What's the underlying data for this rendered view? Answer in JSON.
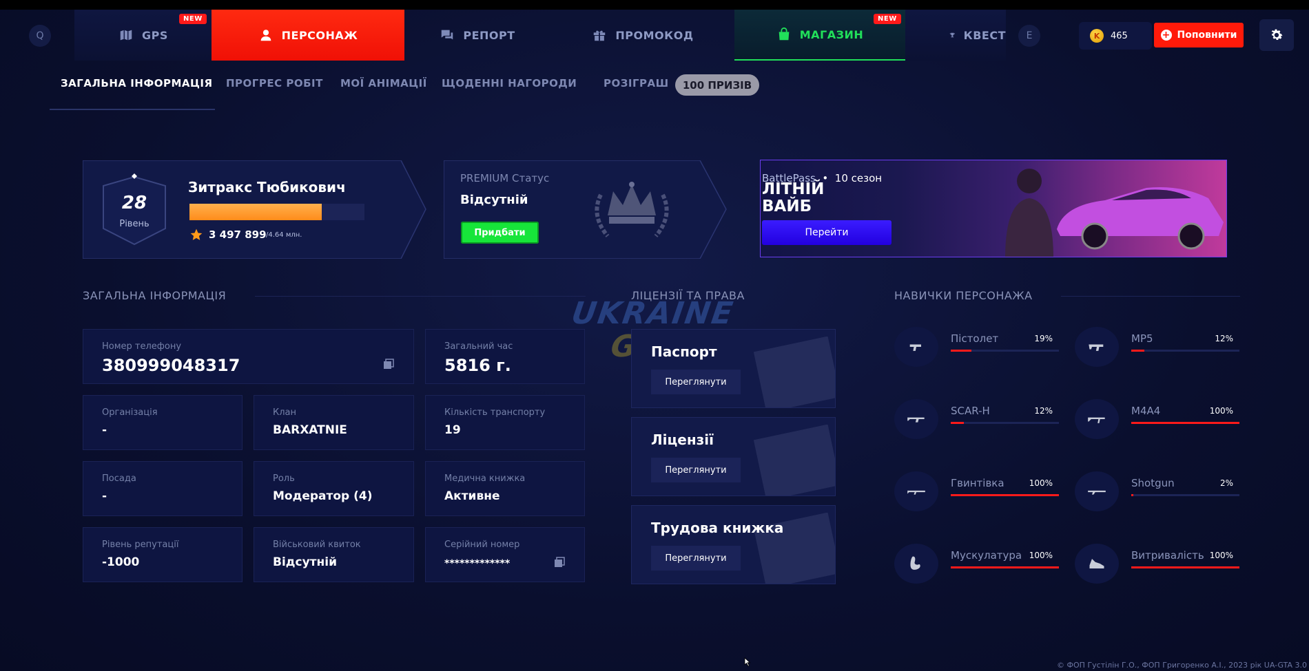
{
  "topnav": {
    "left_key": "Q",
    "right_key": "E",
    "tabs": [
      {
        "label": "GPS",
        "icon": "map-icon",
        "badge": "NEW"
      },
      {
        "label": "ПЕРСОНАЖ",
        "icon": "user-icon"
      },
      {
        "label": "РЕПОРТ",
        "icon": "chat-icon"
      },
      {
        "label": "ПРОМОКОД",
        "icon": "gift-icon"
      },
      {
        "label": "МАГАЗИН",
        "icon": "bag-icon",
        "badge": "NEW"
      },
      {
        "label": "КВЕСТ",
        "icon": "trophy-icon"
      }
    ],
    "active_tab": "ПЕРСОНАЖ",
    "coins": "465",
    "topup_label": "Поповнити",
    "colors": {
      "active_red": "#f01006",
      "shop_green": "#21e05a",
      "badge": "#ff1a1a"
    }
  },
  "subnav": {
    "items": [
      "ЗАГАЛЬНА ІНФОРМАЦІЯ",
      "ПРОГРЕС РОБІТ",
      "МОЇ АНІМАЦІЇ",
      "ЩОДЕННІ НАГОРОДИ",
      "РОЗІГРАШ"
    ],
    "prize_badge": "100 ПРИЗІВ"
  },
  "player": {
    "level": "28",
    "level_label": "Рівень",
    "name": "Зитракс Тюбикович",
    "xp": "3 497 899",
    "xp_max": "/4.64 млн.",
    "xp_progress": 0.754
  },
  "premium": {
    "label": "PREMIUM Статус",
    "value": "Відсутній",
    "button": "Придбати"
  },
  "battlepass": {
    "label": "BattlePass",
    "season": "10 сезон",
    "title": "ЛІТНІЙ ВАЙБ",
    "button": "Перейти"
  },
  "sections": {
    "info": "ЗАГАЛЬНА ІНФОРМАЦІЯ",
    "licenses": "ЛІЦЕНЗІЇ ТА ПРАВА",
    "skills": "НАВИЧКИ ПЕРСОНАЖА"
  },
  "info": {
    "phone": {
      "label": "Номер телефону",
      "value": "380999048317"
    },
    "total_time": {
      "label": "Загальний час",
      "value": "5816 г."
    },
    "organization": {
      "label": "Організація",
      "value": "-"
    },
    "clan": {
      "label": "Клан",
      "value": "BARXATNIE"
    },
    "vehicles": {
      "label": "Кількість транспорту",
      "value": "19"
    },
    "position": {
      "label": "Посада",
      "value": "-"
    },
    "role": {
      "label": "Роль",
      "value": "Модератор (4)"
    },
    "medical": {
      "label": "Медична книжка",
      "value": "Активне"
    },
    "reputation": {
      "label": "Рівень репутації",
      "value": "-1000"
    },
    "military": {
      "label": "Військовий квиток",
      "value": "Відсутній"
    },
    "serial": {
      "label": "Серійний номер",
      "value": "*************"
    }
  },
  "licenses": [
    {
      "title": "Паспорт",
      "button": "Переглянути"
    },
    {
      "title": "Ліцензії",
      "button": "Переглянути"
    },
    {
      "title": "Трудова книжка",
      "button": "Переглянути"
    }
  ],
  "skills": [
    {
      "name": "Пістолет",
      "percent": "19%",
      "value": 0.19,
      "icon": "pistol-icon"
    },
    {
      "name": "MP5",
      "percent": "12%",
      "value": 0.12,
      "icon": "smg-icon"
    },
    {
      "name": "SCAR-H",
      "percent": "12%",
      "value": 0.12,
      "icon": "rifle-icon"
    },
    {
      "name": "M4A4",
      "percent": "100%",
      "value": 1.0,
      "icon": "assault-rifle-icon"
    },
    {
      "name": "Гвинтівка",
      "percent": "100%",
      "value": 1.0,
      "icon": "sniper-rifle-icon"
    },
    {
      "name": "Shotgun",
      "percent": "2%",
      "value": 0.02,
      "icon": "shotgun-icon"
    },
    {
      "name": "Мускулатура",
      "percent": "100%",
      "value": 1.0,
      "icon": "muscle-icon"
    },
    {
      "name": "Витривалість",
      "percent": "100%",
      "value": 1.0,
      "icon": "sneaker-icon"
    }
  ],
  "watermark": {
    "line1": "UKRAINE",
    "line2": "GTA"
  },
  "footer": "© ФОП Густілін Г.О., ФОП Григоренко А.І., 2023 рік UA-GTA 3.0"
}
